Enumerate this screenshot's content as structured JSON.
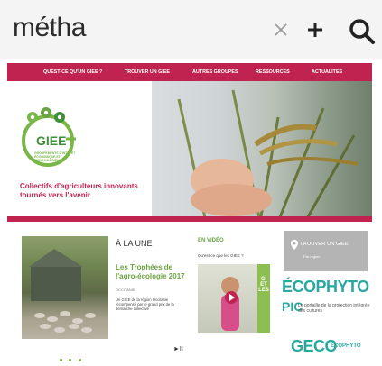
{
  "search": {
    "query": "métha"
  },
  "nav": {
    "items": [
      {
        "label": "QUEST-CE QU'UN GIEE ?"
      },
      {
        "label": "TROUVER UN GIEE"
      },
      {
        "label": "AUTRES GROUPES"
      },
      {
        "label": "RESSOURCES"
      },
      {
        "label": "ACTUALITÉS"
      }
    ]
  },
  "hero": {
    "logo_title": "GIEE",
    "logo_text": "GROUPEMENTS D'INTÉRÊT ÉCONOMIQUE ET ENVIRONNEMENTAL",
    "tagline": "Collectifs d'agriculteurs innovants tournés vers l'avenir"
  },
  "a_la_une": {
    "title": "À LA UNE",
    "headline": "Les Trophées de l'agro-écologie 2017",
    "tag": "OCCITANIE",
    "text": "Un GIEE de la région Occitanie récompensé par le grand prix de la démarche collective"
  },
  "video": {
    "title": "EN VIDÉO",
    "question": "Qu'est-ce que les GIEE ?",
    "panel_text": "GI ET LES"
  },
  "find_giee": {
    "title": "TROUVER UN GIEE",
    "subtitle": "Par région"
  },
  "ecophyto": {
    "logo": "ÉCOPHYTO",
    "pic": "PIC",
    "subtitle": "Le portaille de la protection intégrée des cultures"
  },
  "geco": {
    "logo": "GECO",
    "mini": "ÉCOPHYTO"
  },
  "colors": {
    "brand": "#c0234f",
    "green": "#6aa341",
    "teal": "#2aa8a0"
  }
}
